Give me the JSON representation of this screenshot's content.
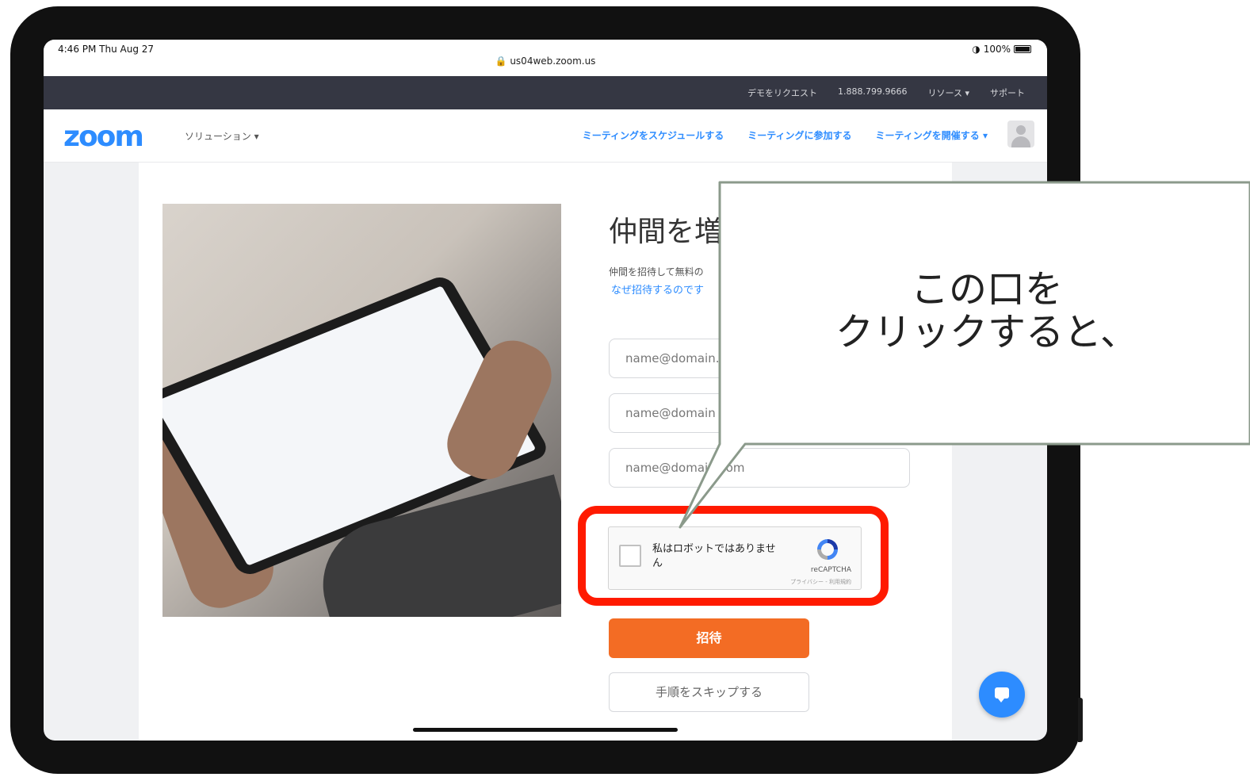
{
  "status_bar": {
    "time": "4:46 PM  Thu Aug 27",
    "url": "us04web.zoom.us",
    "battery": "100%"
  },
  "top_bar": {
    "links": [
      "デモをリクエスト",
      "1.888.799.9666",
      "リソース ▾",
      "サポート"
    ]
  },
  "nav": {
    "logo": "zoom",
    "solutions": "ソリューション ▾",
    "links": [
      "ミーティングをスケジュールする",
      "ミーティングに参加する",
      "ミーティングを開催する ▾"
    ]
  },
  "main": {
    "title": "仲間を増",
    "description": "仲間を招待して無料の",
    "why_link": "なぜ招待するのです",
    "email_placeholders": [
      "name@domain.c",
      "name@domain",
      "name@domain.com"
    ]
  },
  "recaptcha": {
    "label": "私はロボットではありません",
    "brand": "reCAPTCHA",
    "links": "プライバシー - 利用規約"
  },
  "buttons": {
    "invite": "招待",
    "skip": "手順をスキップする"
  },
  "callout": {
    "line1": "この口を",
    "line2": "クリックすると、"
  },
  "colors": {
    "brand_blue": "#2d8cff",
    "invite_orange": "#f36c24",
    "highlight_red": "#ff1a00",
    "dark_bar": "#353743"
  }
}
